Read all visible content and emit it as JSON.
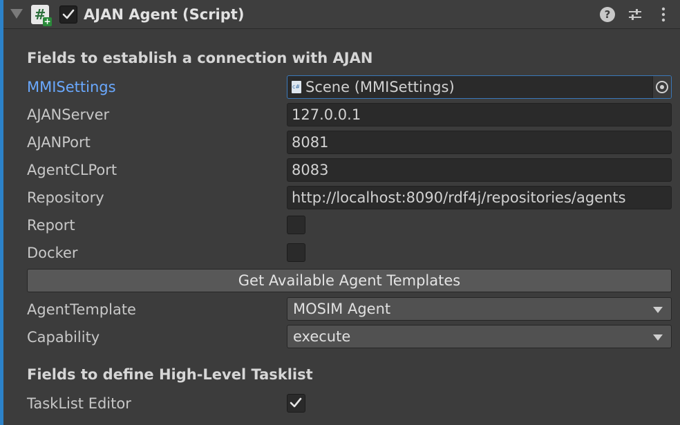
{
  "header": {
    "title": "AJAN Agent (Script)",
    "script_icon_glyph": "#",
    "script_icon_badge": "+",
    "help_glyph": "?",
    "enabled": true,
    "icons": [
      "foldout-arrow-icon",
      "script-icon",
      "help-icon",
      "preset-icon",
      "menu-icon"
    ]
  },
  "section_connection": {
    "label": "Fields to establish a connection with AJAN"
  },
  "fields": {
    "mmi_settings": {
      "label": "MMISettings",
      "value": "Scene (MMISettings)"
    },
    "ajan_server": {
      "label": "AJANServer",
      "value": "127.0.0.1"
    },
    "ajan_port": {
      "label": "AJANPort",
      "value": "8081"
    },
    "agent_cl_port": {
      "label": "AgentCLPort",
      "value": "8083"
    },
    "repository": {
      "label": "Repository",
      "value": "http://localhost:8090/rdf4j/repositories/agents"
    },
    "report": {
      "label": "Report",
      "checked": false
    },
    "docker": {
      "label": "Docker",
      "checked": false
    }
  },
  "get_templates_button": {
    "label": "Get Available Agent Templates"
  },
  "dropdowns": {
    "agent_template": {
      "label": "AgentTemplate",
      "value": "MOSIM Agent"
    },
    "capability": {
      "label": "Capability",
      "value": "execute"
    }
  },
  "section_tasklist": {
    "label": "Fields to define High-Level Tasklist"
  },
  "tasklist_editor": {
    "label": "TaskList Editor",
    "checked": true
  },
  "colors": {
    "accent": "#2c82c9",
    "link": "#6aa9ff",
    "background": "#3c3c3c",
    "field": "#2a2a2a"
  }
}
